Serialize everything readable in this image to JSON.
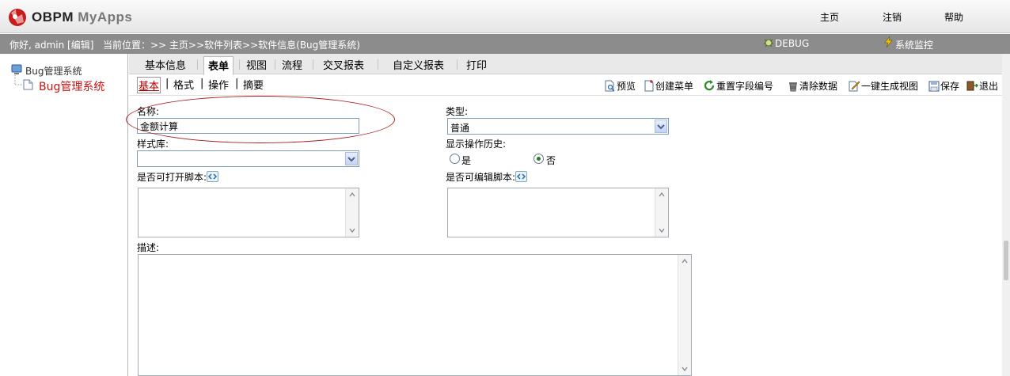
{
  "header": {
    "logo_main": "OBPM",
    "logo_app": "MyApps",
    "links": {
      "home": "主页",
      "logout": "注销",
      "help": "帮助"
    }
  },
  "status": {
    "greeting": "你好, admin [编辑]",
    "location": "当前位置：>> 主页>>软件列表>>软件信息(Bug管理系统)",
    "debug": "DEBUG",
    "monitor": "系统监控"
  },
  "sidebar": {
    "root": "Bug管理系统",
    "child": "Bug管理系统"
  },
  "tabs": [
    "基本信息",
    "表单",
    "视图",
    "流程",
    "交叉报表",
    "自定义报表",
    "打印"
  ],
  "subtabs": [
    "基本",
    "格式",
    "操作",
    "摘要"
  ],
  "toolbar": {
    "preview": "预览",
    "create_menu": "创建菜单",
    "reset_field_no": "重置字段编号",
    "clear_data": "清除数据",
    "generate_view": "一键生成视图",
    "save": "保存",
    "exit": "退出"
  },
  "form": {
    "name_label": "名称:",
    "name_value": "金额计算",
    "type_label": "类型:",
    "type_value": "普通",
    "style_label": "样式库:",
    "style_value": "",
    "history_label": "显示操作历史:",
    "history_yes": "是",
    "history_no": "否",
    "history_selected": "否",
    "open_script_label": "是否可打开脚本:",
    "edit_script_label": "是否可编辑脚本:",
    "desc_label": "描述:"
  },
  "colors": {
    "annotation": "#b02020",
    "tree_selected": "#cc1111",
    "status_bar": "#8c8c8c"
  }
}
